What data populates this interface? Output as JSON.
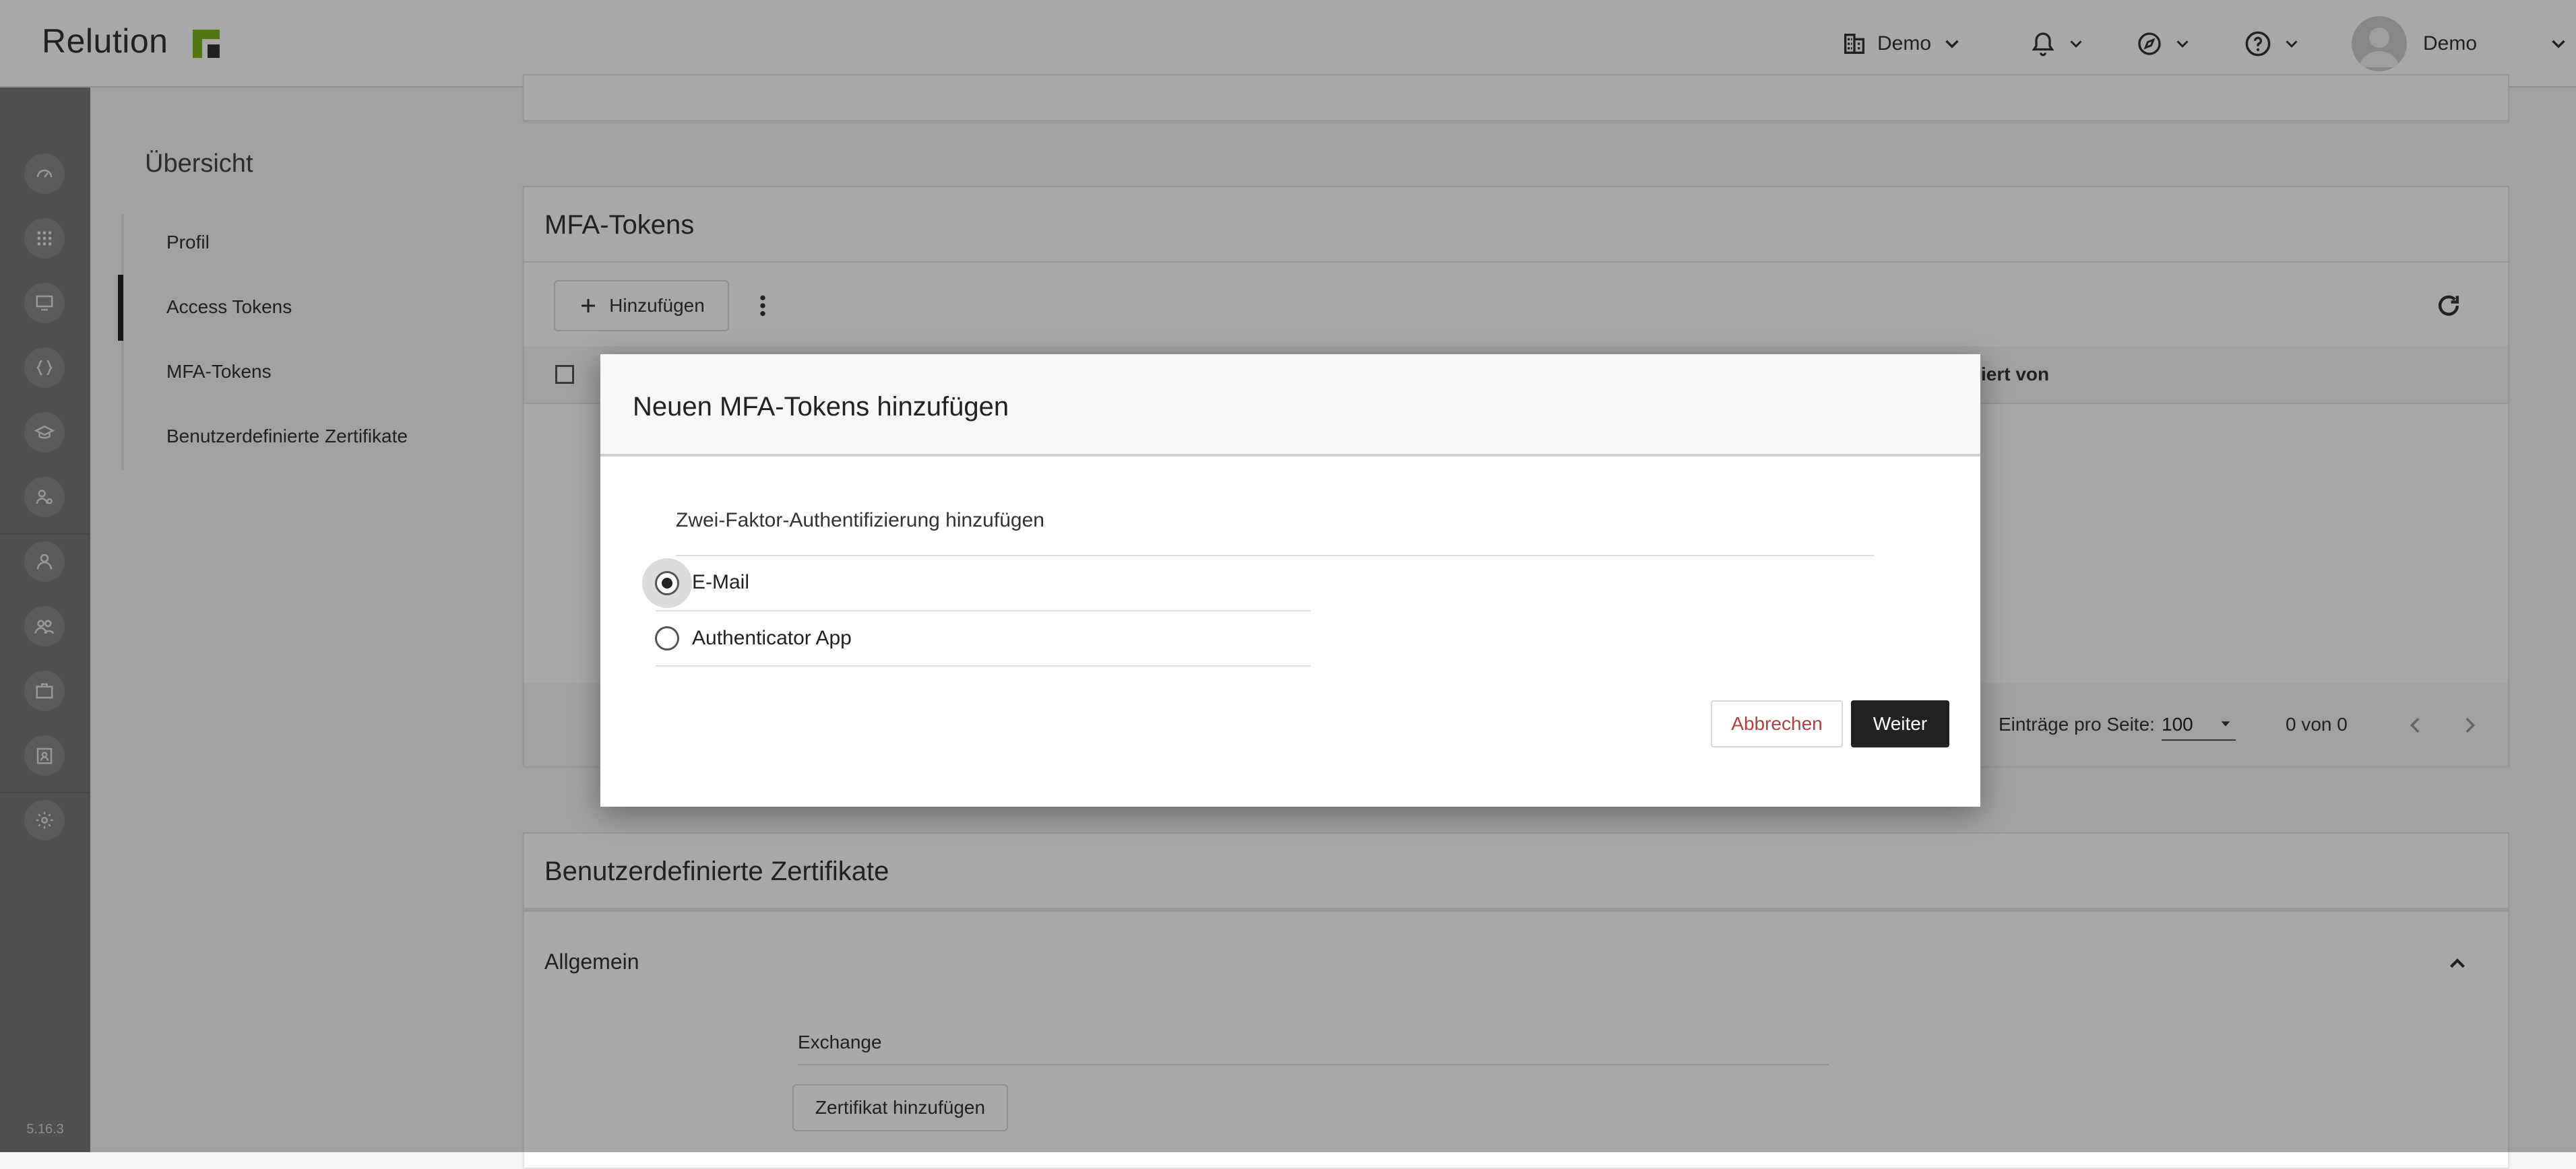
{
  "app": {
    "logo_text": "Relution"
  },
  "header": {
    "org_label": "Demo",
    "user_label": "Demo"
  },
  "sidebar": {
    "version": "5.16.3"
  },
  "left_nav": {
    "title": "Übersicht",
    "items": [
      "Profil",
      "Access Tokens",
      "MFA-Tokens",
      "Benutzerdefinierte Zertifikate"
    ],
    "active_index": 1
  },
  "mfa_card": {
    "title": "MFA-Tokens",
    "add_label": "Hinzufügen",
    "column_partial": "ziert von",
    "entries_label": "Einträge pro Seite:",
    "entries_value": "100",
    "range_label": "0 von 0"
  },
  "cert_card": {
    "title": "Benutzerdefinierte Zertifikate",
    "section_title": "Allgemein",
    "field_label": "Exchange",
    "add_cert_label": "Zertifikat hinzufügen"
  },
  "modal": {
    "title": "Neuen MFA-Tokens hinzufügen",
    "subtitle": "Zwei-Faktor-Authentifizierung hinzufügen",
    "options": [
      "E-Mail",
      "Authenticator App"
    ],
    "selected_index": 0,
    "cancel_label": "Abbrechen",
    "next_label": "Weiter"
  },
  "colors": {
    "brand_green": "#7ab51d",
    "cancel_text": "#b0413e",
    "primary_button": "#222222"
  }
}
